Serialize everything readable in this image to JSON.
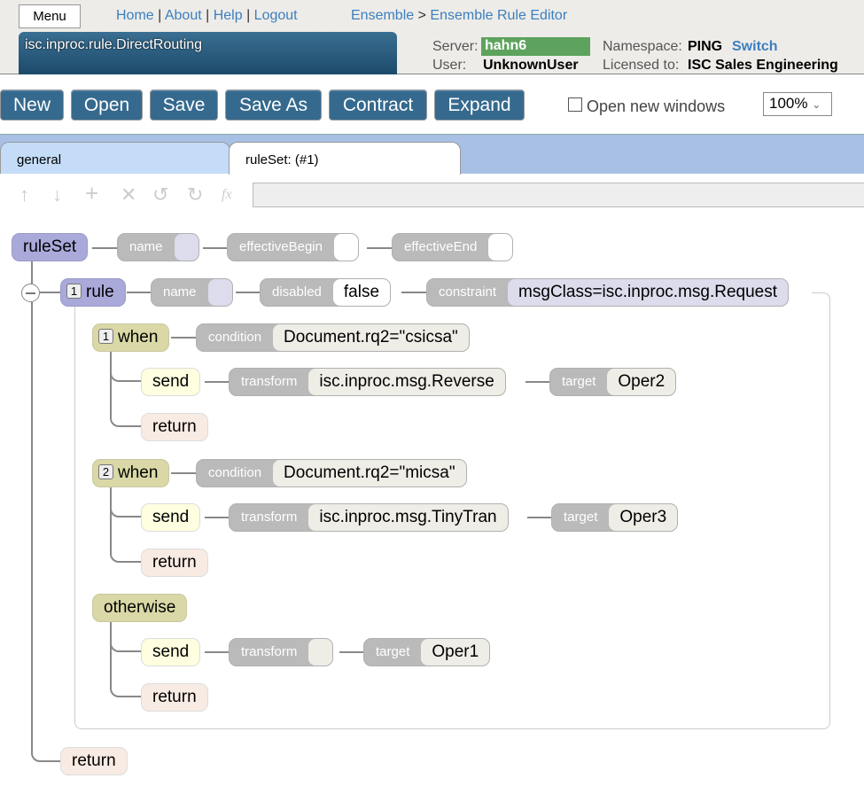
{
  "header": {
    "menu": "Menu",
    "links": [
      "Home",
      "About",
      "Help",
      "Logout"
    ],
    "breadcrumb": [
      "Ensemble",
      ">",
      "Ensemble Rule Editor"
    ],
    "title": "isc.inproc.rule.DirectRouting",
    "server_label": "Server:",
    "server": "hahn6",
    "namespace_label": "Namespace:",
    "namespace": "PING",
    "switch": "Switch",
    "user_label": "User:",
    "user": "UnknownUser",
    "licensed_label": "Licensed to:",
    "licensed": "ISC Sales Engineering",
    "server_color": "#5da35d"
  },
  "toolbar": {
    "buttons": [
      "New",
      "Open",
      "Save",
      "Save As",
      "Contract",
      "Expand"
    ],
    "open_new_windows": "Open new windows",
    "open_new_windows_checked": false,
    "zoom": "100%"
  },
  "tabs": [
    {
      "label": "general",
      "active": false
    },
    {
      "label": "ruleSet: (#1)",
      "active": true
    }
  ],
  "edit_icons": [
    "arrow-up-icon",
    "arrow-down-icon",
    "plus-icon",
    "delete-icon",
    "undo-icon",
    "redo-icon",
    "function-icon"
  ],
  "tree": {
    "ruleset": {
      "label": "ruleSet",
      "props": [
        {
          "label": "name",
          "value": ""
        },
        {
          "label": "effectiveBegin",
          "value": ""
        },
        {
          "label": "effectiveEnd",
          "value": ""
        }
      ]
    },
    "rule": {
      "num": "1",
      "label": "rule",
      "props": [
        {
          "label": "name",
          "value": ""
        },
        {
          "label": "disabled",
          "value": "false"
        },
        {
          "label": "constraint",
          "value": "msgClass=isc.inproc.msg.Request"
        }
      ]
    },
    "when1": {
      "num": "1",
      "label": "when",
      "cond_label": "condition",
      "cond": "Document.rq2=\"csicsa\"",
      "send": "send",
      "transform_label": "transform",
      "transform": "isc.inproc.msg.Reverse",
      "target_label": "target",
      "target": "Oper2",
      "return": "return"
    },
    "when2": {
      "num": "2",
      "label": "when",
      "cond_label": "condition",
      "cond": "Document.rq2=\"micsa\"",
      "send": "send",
      "transform_label": "transform",
      "transform": "isc.inproc.msg.TinyTran",
      "target_label": "target",
      "target": "Oper3",
      "return": "return"
    },
    "otherwise": {
      "label": "otherwise",
      "send": "send",
      "transform_label": "transform",
      "transform": "",
      "target_label": "target",
      "target": "Oper1",
      "return": "return"
    },
    "final_return": "return"
  }
}
